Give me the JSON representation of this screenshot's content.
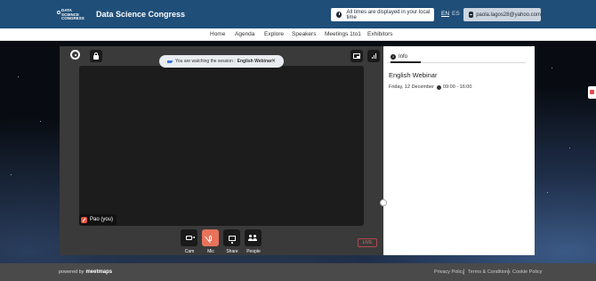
{
  "header": {
    "logo_lines": [
      "DATA",
      "SCIENCE",
      "CONGRESS"
    ],
    "title": "Data Science Congress",
    "timezone_notice": "All times are displayed in your local time",
    "lang_en": "EN",
    "lang_es": "ES",
    "user_email": "paola.lagos28@yahoo.com"
  },
  "nav": {
    "items": [
      "Home",
      "Agenda",
      "Explore",
      "Speakers",
      "Meetings 1to1",
      "Exhibitors"
    ]
  },
  "player": {
    "watching_prefix": "You are watching the session :",
    "watching_session": "English Webinar",
    "participant_label": "Pao (you)",
    "controls": [
      "Cam",
      "Mic",
      "Share",
      "People"
    ],
    "live_label": "LIVE"
  },
  "info": {
    "tab_label": "Info",
    "session_title": "English Webinar",
    "session_date": "Friday, 12 December",
    "session_time": "09:00 - 16:00"
  },
  "footer": {
    "powered_by": "powered by",
    "brand": "meetmaps",
    "links": [
      "Privacy Policy",
      "Terms & Conditions",
      "Cookie Policy"
    ]
  },
  "colors": {
    "header_bg": "#1f4e79",
    "mic_muted": "#e8735a",
    "live": "#d76c6c"
  }
}
